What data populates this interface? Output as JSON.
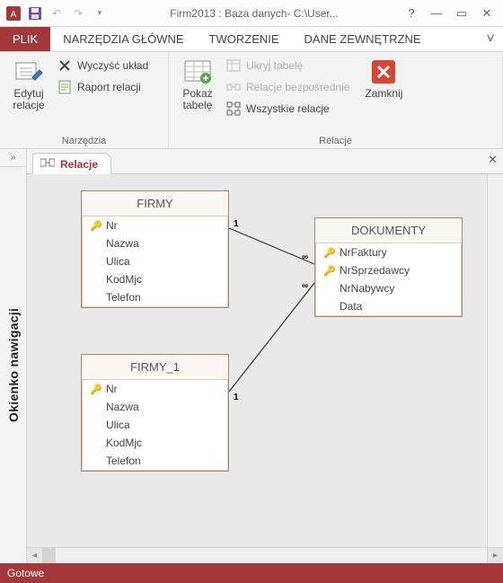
{
  "titlebar": {
    "title": "Firm2013 : Baza danych- C:\\User..."
  },
  "ribbon_tabs": {
    "file": "PLIK",
    "home": "NARZĘDZIA GŁÓWNE",
    "create": "TWORZENIE",
    "external": "DANE ZEWNĘTRZNE"
  },
  "ribbon": {
    "tools_group": "Narzędzia",
    "relations_group": "Relacje",
    "edit_relations": "Edytuj relacje",
    "clear_layout": "Wyczyść układ",
    "relation_report": "Raport relacji",
    "show_table": "Pokaż tabelę",
    "hide_table": "Ukryj tabelę",
    "direct_relations": "Relacje bezpośrednie",
    "all_relations": "Wszystkie relacje",
    "close": "Zamknij"
  },
  "nav_pane": {
    "title": "Okienko nawigacji"
  },
  "doc": {
    "tab_label": "Relacje"
  },
  "tables": {
    "firmy": {
      "title": "FIRMY",
      "fields": [
        "Nr",
        "Nazwa",
        "Ulica",
        "KodMjc",
        "Telefon"
      ],
      "pk": [
        true,
        false,
        false,
        false,
        false
      ]
    },
    "firmy1": {
      "title": "FIRMY_1",
      "fields": [
        "Nr",
        "Nazwa",
        "Ulica",
        "KodMjc",
        "Telefon"
      ],
      "pk": [
        true,
        false,
        false,
        false,
        false
      ]
    },
    "dokumenty": {
      "title": "DOKUMENTY",
      "fields": [
        "NrFaktury",
        "NrSprzedawcy",
        "NrNabywcy",
        "Data"
      ],
      "pk": [
        true,
        true,
        false,
        false
      ]
    }
  },
  "cardinality": {
    "one": "1",
    "many": "∞"
  },
  "status": {
    "text": "Gotowe"
  }
}
